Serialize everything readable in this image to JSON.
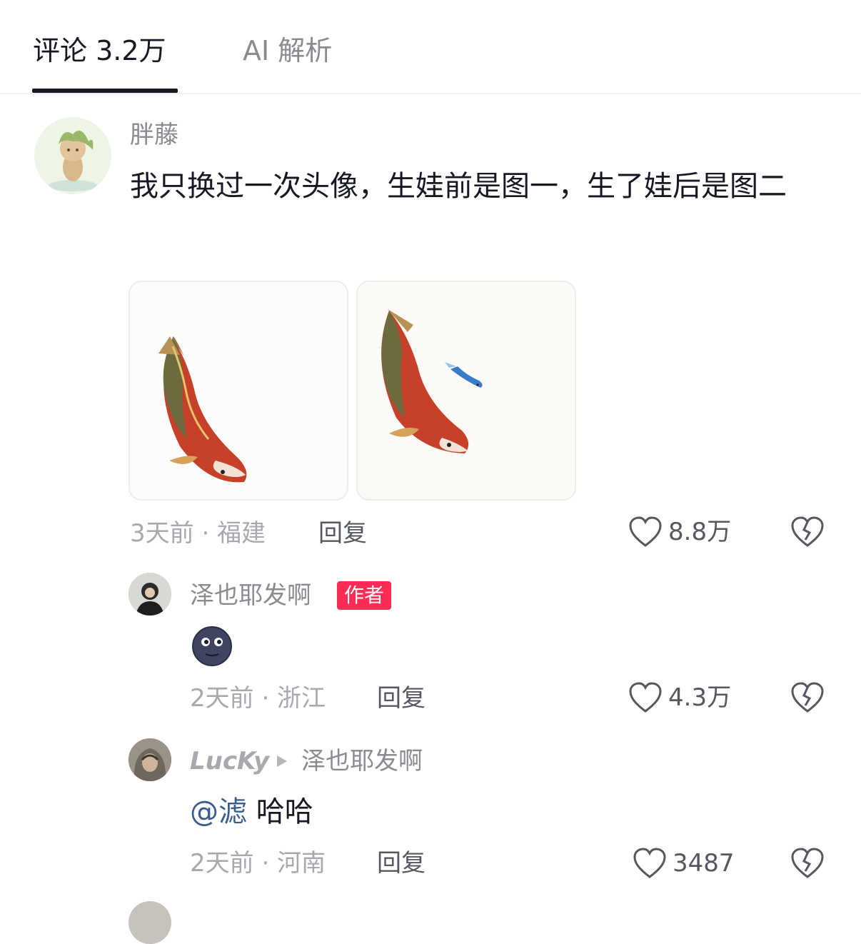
{
  "tabs": {
    "comments_label": "评论 3.2万",
    "ai_label": "AI 解析"
  },
  "comments": [
    {
      "username": "胖藤",
      "text": "我只换过一次头像，生娃前是图一，生了娃后是图二",
      "time_location": "3天前 · 福建",
      "reply_label": "回复",
      "likes": "8.8万",
      "avatar_icon": "plant-doll-avatar",
      "images": [
        "koi-fish-image",
        "koi-with-small-fish-image"
      ]
    }
  ],
  "replies": [
    {
      "username": "泽也耶发啊",
      "badge": "作者",
      "emoji_icon": "moon-face-emoji-icon",
      "time_location": "2天前 · 浙江",
      "reply_label": "回复",
      "likes": "4.3万"
    },
    {
      "username": "LucKy",
      "reply_to": "泽也耶发啊",
      "mention": "@滤",
      "text": "哈哈",
      "time_location": "2天前 · 河南",
      "reply_label": "回复",
      "likes": "3487"
    }
  ],
  "colors": {
    "badge": "#fe2c55",
    "mention": "#3a5d8f",
    "secondary_text": "#8a8b91"
  }
}
